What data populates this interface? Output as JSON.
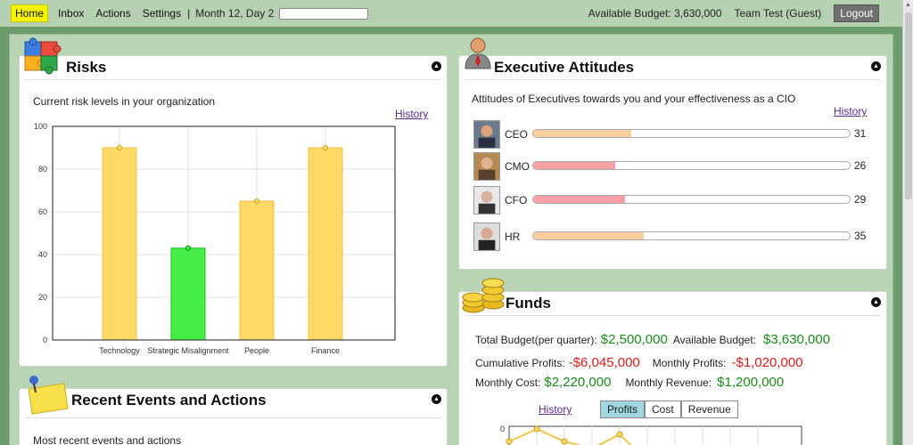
{
  "topbar": {
    "nav": [
      "Home",
      "Inbox",
      "Actions",
      "Settings"
    ],
    "separator": "|",
    "date": "Month 12, Day 2",
    "day_progress": 0.0,
    "budget": "Available Budget: 3,630,000",
    "team": "Team Test (Guest)",
    "logout": "Logout"
  },
  "risks": {
    "title": "Risks",
    "description": "Current risk levels in your organization",
    "history": "History",
    "chart_data": {
      "type": "bar",
      "categories": [
        "Technology",
        "Strategic Misalignment",
        "People",
        "Finance"
      ],
      "values": [
        90,
        43,
        65,
        90
      ],
      "colors": [
        "#ffd966",
        "#44ee44",
        "#ffd966",
        "#ffd966"
      ],
      "ylim": [
        0,
        100
      ],
      "yticks": [
        0,
        20,
        40,
        60,
        80,
        100
      ],
      "grid": true
    }
  },
  "events": {
    "title": "Recent Events and Actions",
    "description": "Most recent events and actions"
  },
  "executives": {
    "title": "Executive Attitudes",
    "description": "Attitudes of Executives towards you and your effectiveness as a CIO",
    "history": "History",
    "rows": [
      {
        "label": "CEO",
        "value": "31",
        "level": 31,
        "color": "#f9cfa0"
      },
      {
        "label": "CMO",
        "value": "26",
        "level": 26,
        "color": "#f7a0a8"
      },
      {
        "label": "CFO",
        "value": "29",
        "level": 29,
        "color": "#f7a0a8"
      },
      {
        "label": "HR",
        "value": "35",
        "level": 35,
        "color": "#f9cfa0"
      }
    ]
  },
  "funds": {
    "title": "Funds",
    "total_budget_label": "Total Budget(per quarter):",
    "total_budget": "$2,500,000",
    "available_budget_label": "Available Budget:",
    "available_budget": "$3,630,000",
    "cumulative_profits_label": "Cumulative Profits:",
    "cumulative_profits": "-$6,045,000",
    "monthly_profits_label": "Monthly Profits:",
    "monthly_profits": "-$1,020,000",
    "monthly_cost_label": "Monthly Cost:",
    "monthly_cost": "$2,220,000",
    "monthly_revenue_label": "Monthly Revenue:",
    "monthly_revenue": "$1,200,000",
    "history": "History",
    "tabs": [
      "Profits",
      "Cost",
      "Revenue"
    ],
    "active_tab": "Profits",
    "chart_axis_top": "0"
  },
  "colors": {
    "background": "#6b9a6b",
    "main": "#b9d4b5",
    "home_highlight": "#f4f400",
    "positive": "#1a8a1a",
    "negative": "#e01a1a"
  }
}
